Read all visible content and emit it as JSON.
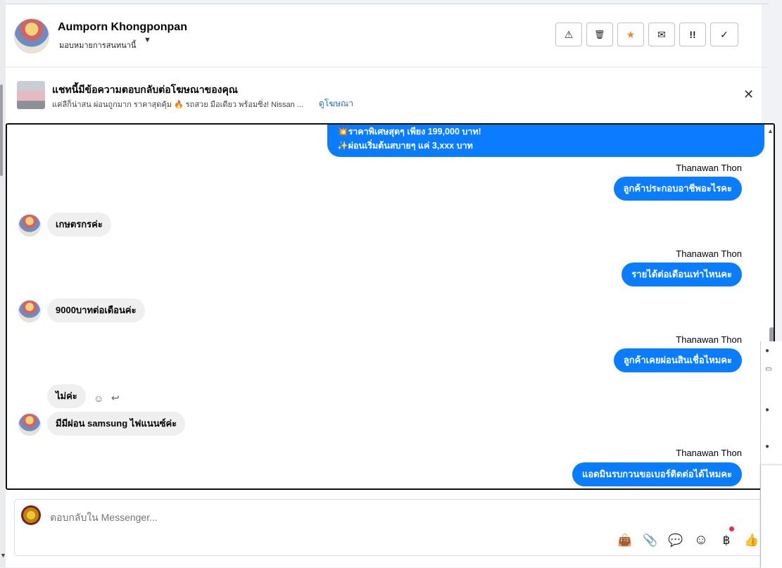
{
  "header": {
    "name": "Aumporn Khongponpan",
    "subtitle": "มอบหมายการสนทนานี้",
    "actions": [
      {
        "icon": "warning-icon",
        "glyph": "⚠"
      },
      {
        "icon": "trash-icon",
        "glyph": "🗑"
      },
      {
        "icon": "star-icon",
        "glyph": "★"
      },
      {
        "icon": "envelope-icon",
        "glyph": "✉"
      },
      {
        "icon": "urgent-icon",
        "glyph": "!!"
      },
      {
        "icon": "check-icon",
        "glyph": "✓"
      }
    ]
  },
  "ad_banner": {
    "title": "แชทนี้มีข้อความตอบกลับต่อโฆษณาของคุณ",
    "description": "แค่ลีก็น่าสน ผ่อนถูกมาก ราคาสุดคุ้ม 🔥 รถสวย มือเดียว พร้อมซิ่ง! Nissan ...",
    "link": "ดูโฆษณา",
    "close_glyph": "✕"
  },
  "messages": {
    "first_out_lines": [
      "💥ราคาพิเศษสุดๆ เพียง 199,000 บาท!",
      "✨ผ่อนเริ่มต้นสบายๆ แค่ 3,xxx บาท"
    ],
    "sender": "Thanawan Thon",
    "out1": "ลูกค้าประกอบอาชีพอะไรคะ",
    "in1": "เกษตรกรค่ะ",
    "out2": "รายได้ต่อเดือนเท่าไหนคะ",
    "in2": "9000บาทต่อเดือนค่ะ",
    "out3": "ลูกค้าเคยผ่อนสินเชื่อไหมคะ",
    "in3a": "ไม่ค่ะ",
    "in3b": "มีมีผ่อน samsung ไฟแนนซ์ค่ะ",
    "out4": "แอดมินรบกวนขอเบอร์ติดต่อได้ไหมคะ"
  },
  "composer": {
    "placeholder": "ตอบกลับใน Messenger...",
    "tools": [
      {
        "icon": "bag-icon",
        "glyph": "👜"
      },
      {
        "icon": "paperclip-icon",
        "glyph": "📎"
      },
      {
        "icon": "chat-bubble-icon",
        "glyph": "💬"
      },
      {
        "icon": "emoji-icon",
        "glyph": "☺"
      },
      {
        "icon": "baht-icon",
        "glyph": "฿"
      },
      {
        "icon": "thumbs-up-icon",
        "glyph": "👍"
      }
    ]
  },
  "colors": {
    "outgoing": "#0a7cff",
    "incoming": "#efefef",
    "link": "#216fdb",
    "star": "#f08a24"
  }
}
